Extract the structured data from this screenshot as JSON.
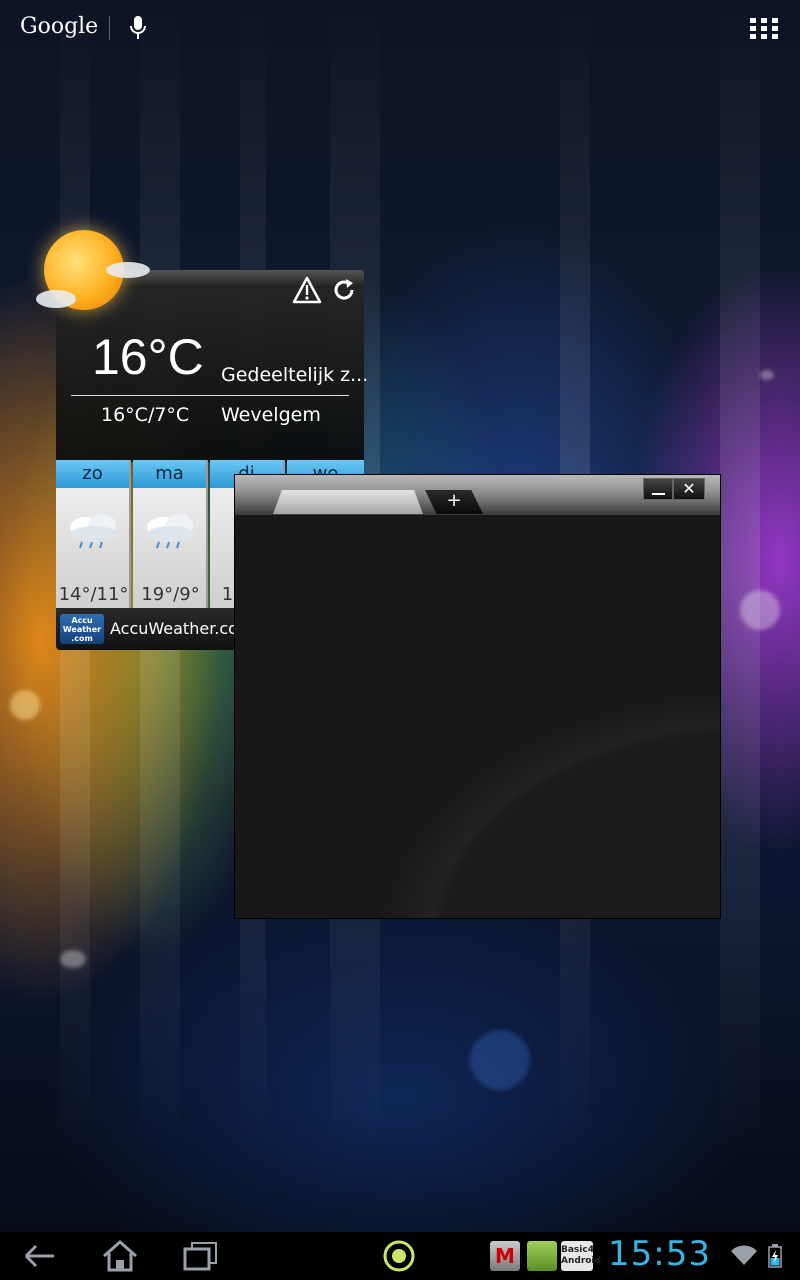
{
  "topbar": {
    "google_label": "Google",
    "icons": [
      "mic-icon",
      "apps-icon"
    ]
  },
  "weather": {
    "temperature": "16°C",
    "condition": "Gedeeltelijk z...",
    "range": "16°C/7°C",
    "location": "Wevelgem",
    "icons": [
      "sun-icon",
      "warning-icon",
      "refresh-icon"
    ],
    "forecast": [
      {
        "day": "zo",
        "temp": "14°/11°"
      },
      {
        "day": "ma",
        "temp": "19°/9°"
      },
      {
        "day": "di",
        "temp": "1"
      },
      {
        "day": "wo",
        "temp": ""
      }
    ],
    "provider_logo": "Accu Weather .com",
    "provider": "AccuWeather.com"
  },
  "floating_window": {
    "new_tab_label": "+",
    "close_label": "✕",
    "buttons": [
      "minimize-button",
      "close-button"
    ]
  },
  "systembar": {
    "clock": "15:53",
    "notifications": [
      "mcafee-icon",
      "android-app-icon",
      "basic4android-icon"
    ],
    "notification_labels": {
      "mcafee": "M",
      "basic4android": "Basic4 Android"
    },
    "icons": [
      "back-icon",
      "home-icon",
      "recents-icon",
      "launcher-circle-icon",
      "wifi-icon",
      "battery-icon"
    ]
  },
  "colors": {
    "clock": "#33b5e5",
    "forecast_header": "#2b98d5",
    "launcher_circle": "#c8e66a"
  }
}
